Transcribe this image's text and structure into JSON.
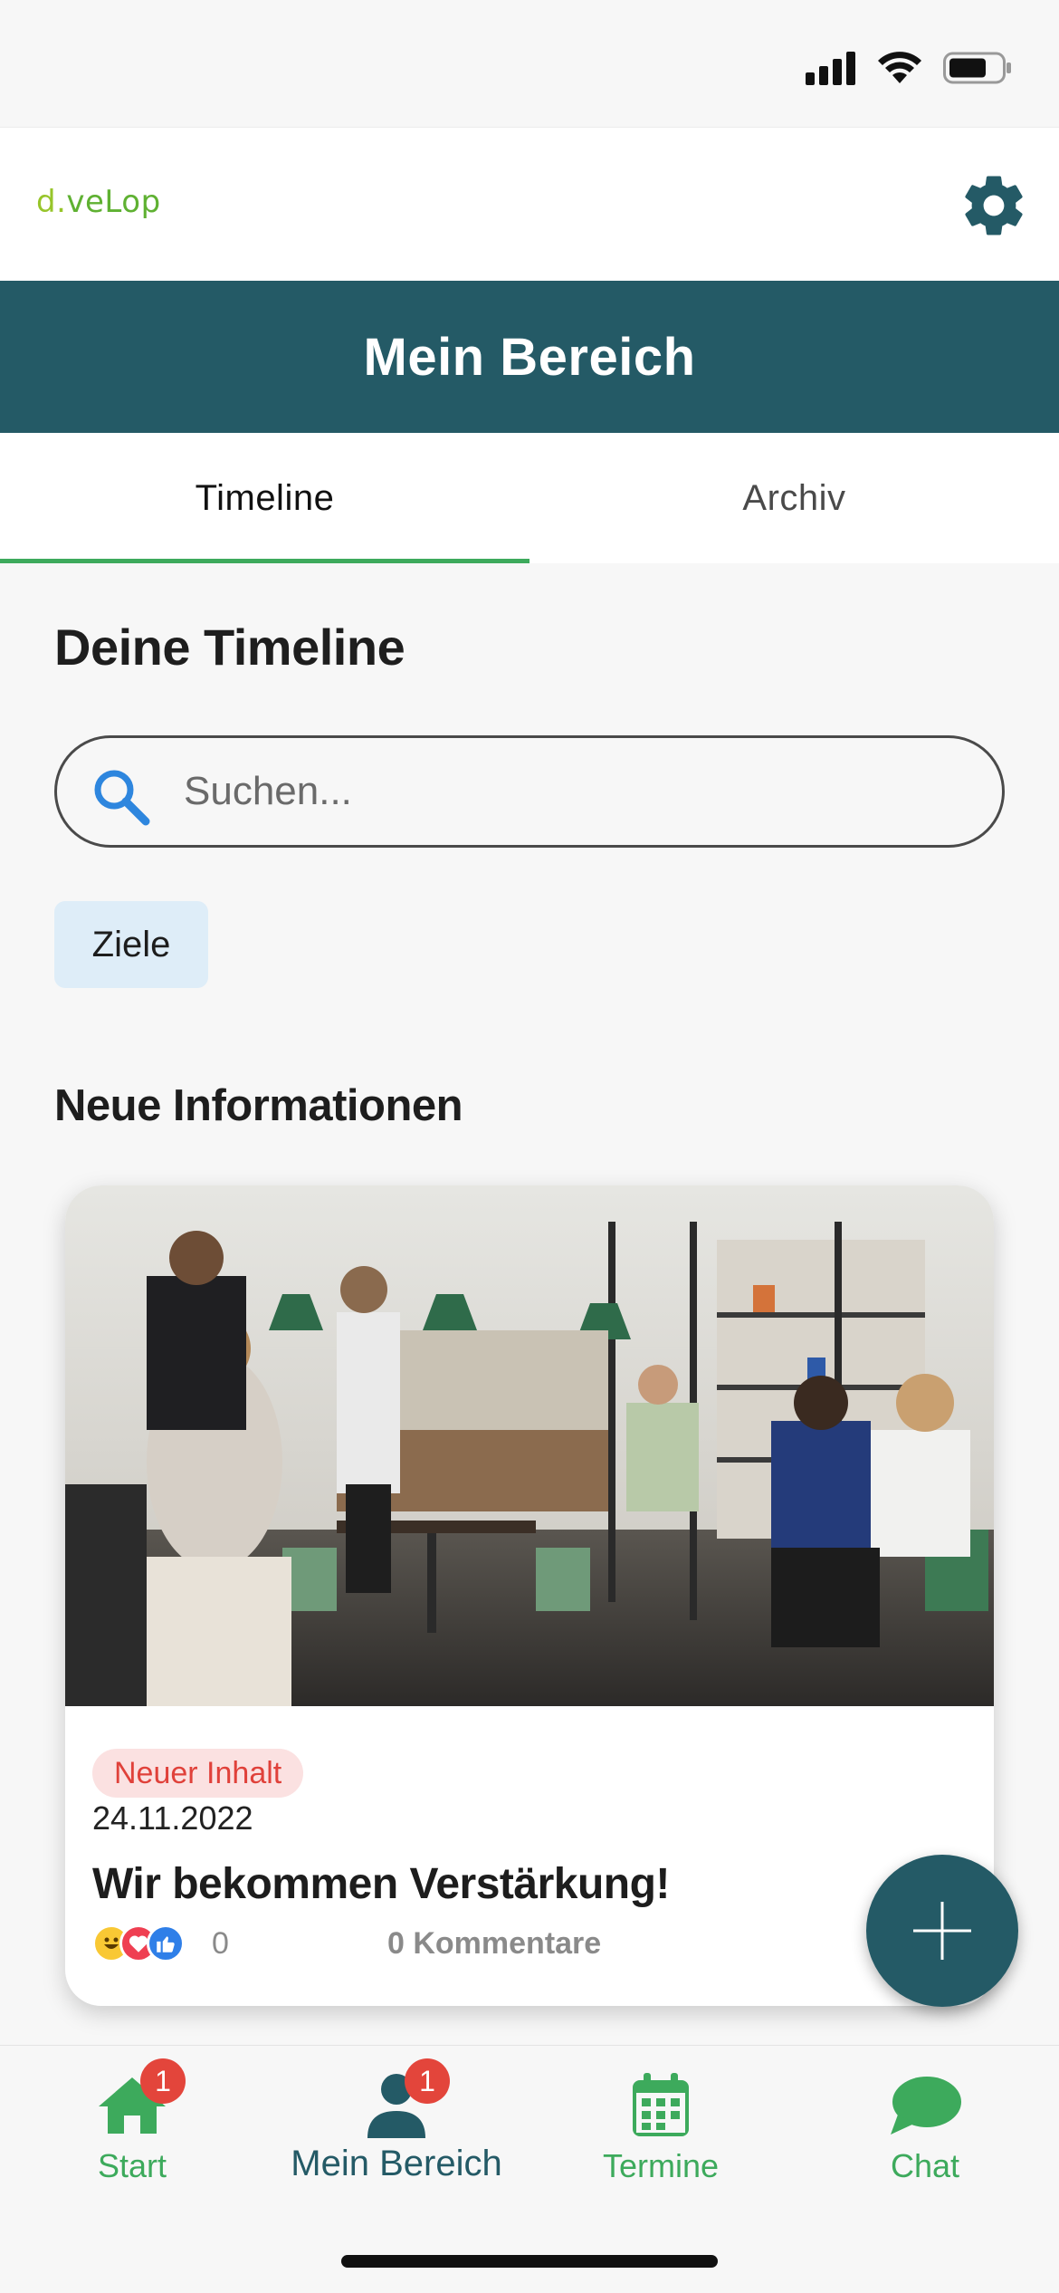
{
  "brand": {
    "d": "d.",
    "rest": "veLop"
  },
  "header": {
    "title": "Mein Bereich"
  },
  "tabs": [
    {
      "label": "Timeline",
      "active": true
    },
    {
      "label": "Archiv",
      "active": false
    }
  ],
  "timeline": {
    "heading": "Deine Timeline",
    "search": {
      "placeholder": "Suchen...",
      "value": ""
    },
    "filter_chip": "Ziele"
  },
  "news": {
    "heading": "Neue Informationen",
    "card": {
      "image": "restaurant-photo",
      "badge": "Neuer Inhalt",
      "date": "24.11.2022",
      "title": "Wir bekommen Verstärkung!",
      "reaction_icons": [
        "laugh-reaction-icon",
        "heart-reaction-icon",
        "like-reaction-icon"
      ],
      "reaction_count": "0",
      "comments": "0 Kommentare"
    }
  },
  "fab": {
    "icon": "plus-icon"
  },
  "bottom_nav": [
    {
      "label": "Start",
      "icon": "home-icon",
      "badge": "1",
      "active": false
    },
    {
      "label": "Mein Bereich",
      "icon": "person-icon",
      "badge": "1",
      "active": true
    },
    {
      "label": "Termine",
      "icon": "calendar-icon",
      "badge": null,
      "active": false
    },
    {
      "label": "Chat",
      "icon": "chat-icon",
      "badge": null,
      "active": false
    }
  ],
  "colors": {
    "primary": "#245a66",
    "accent_green": "#3daa5c",
    "badge_red": "#e3453b",
    "chip_bg": "#deedf8",
    "new_badge_bg": "#fbe1e1",
    "new_badge_text": "#e0413a"
  }
}
